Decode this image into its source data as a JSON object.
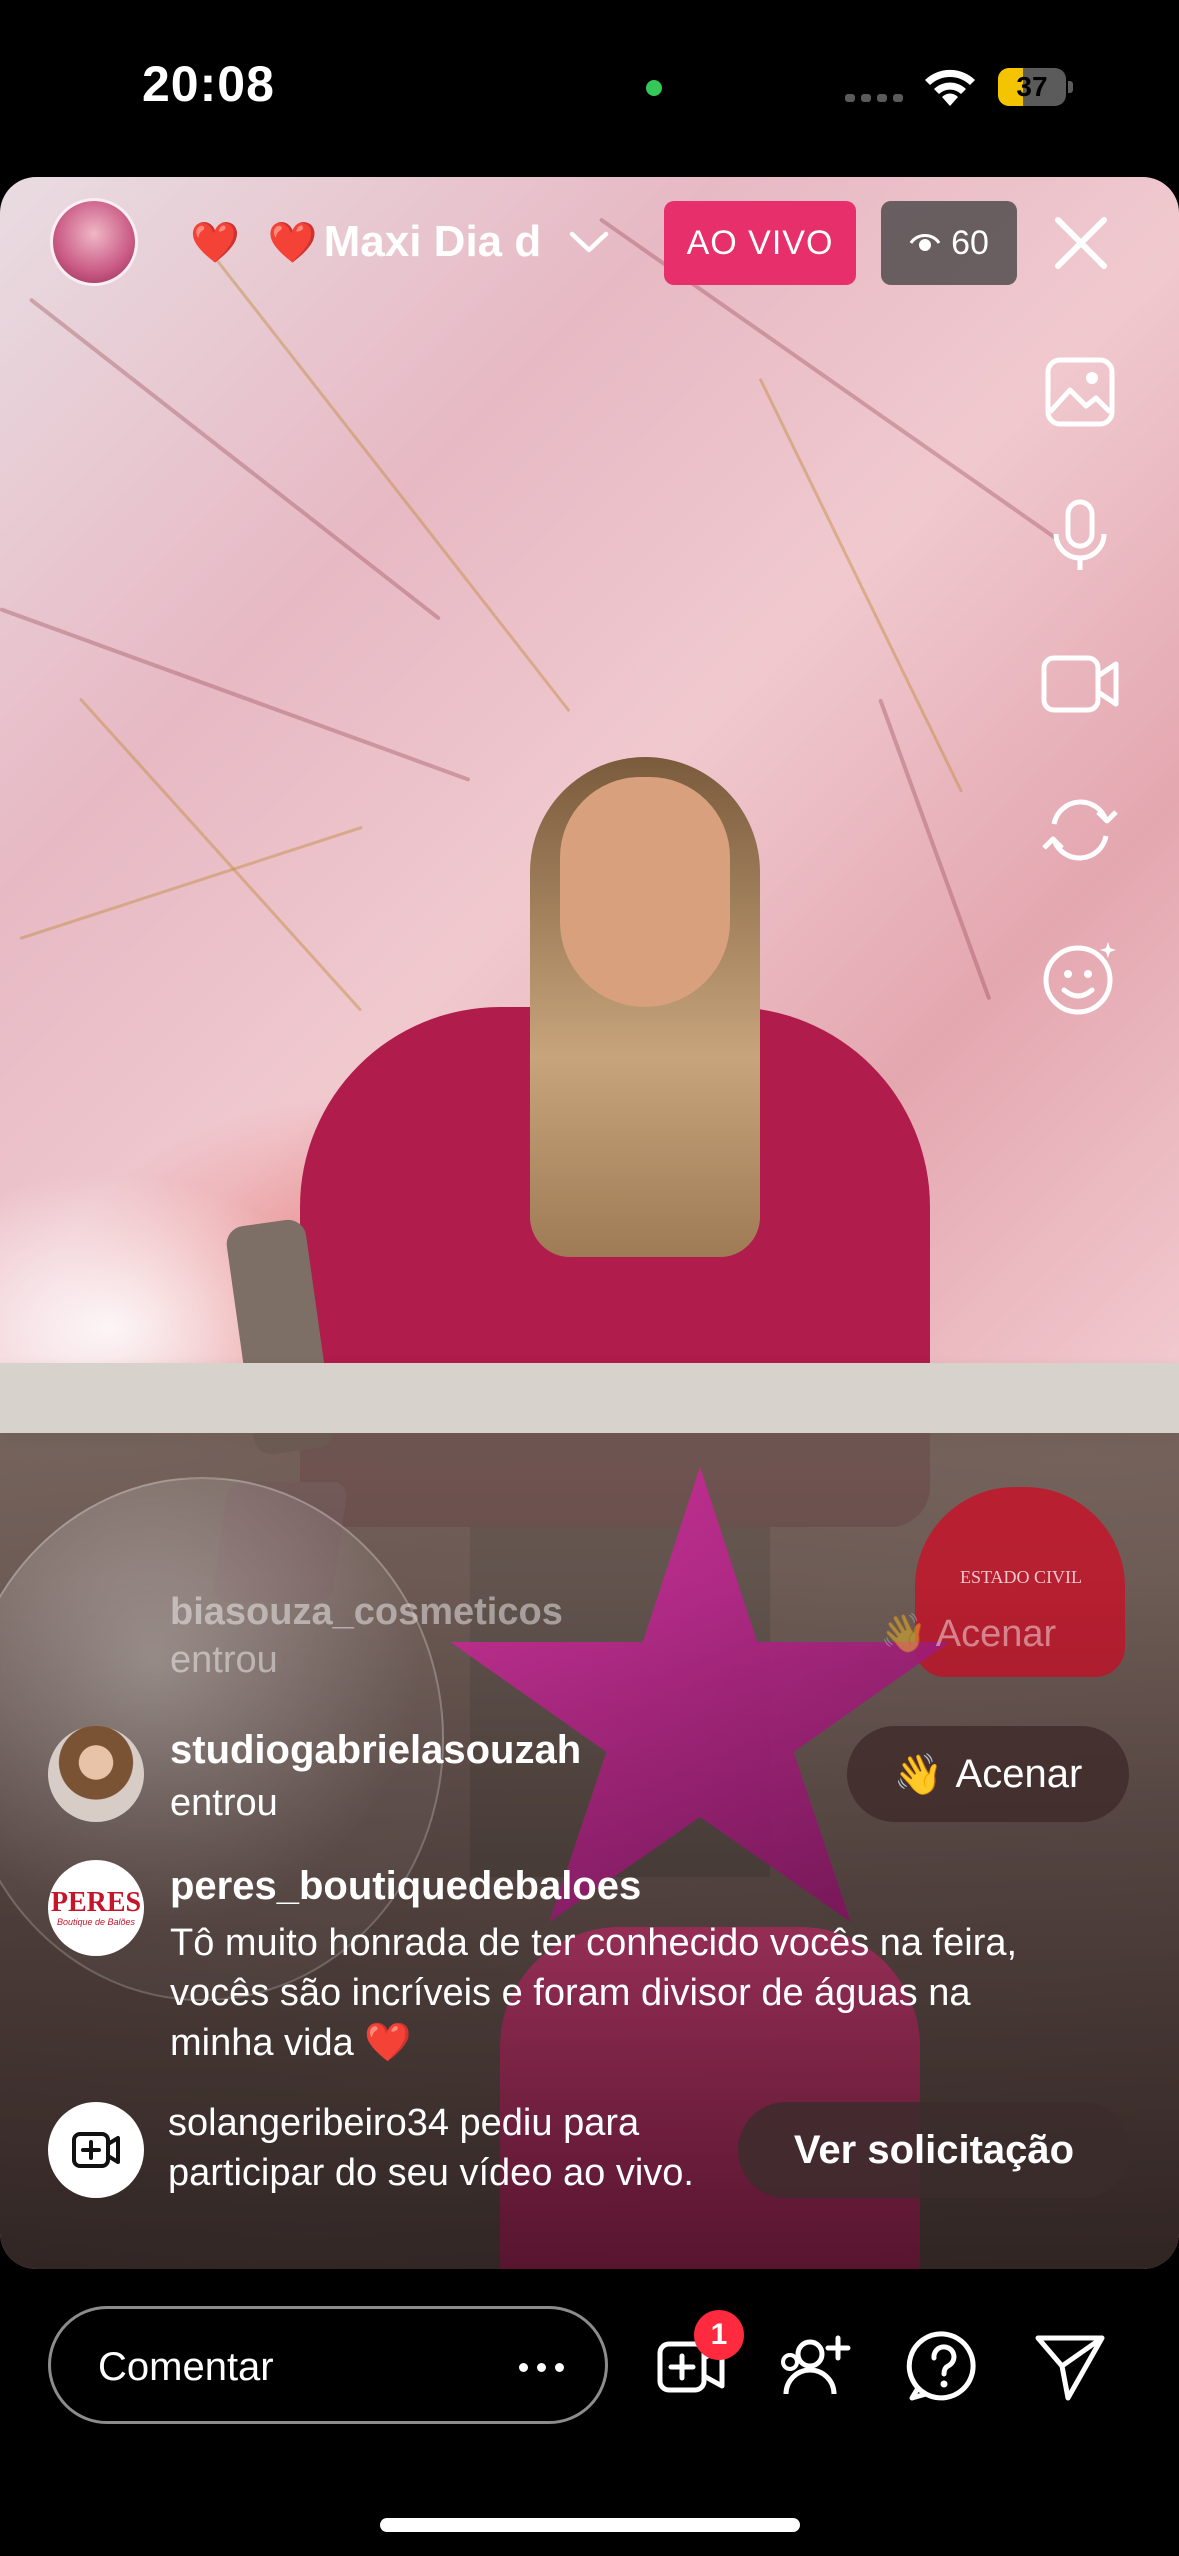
{
  "status_bar": {
    "time": "20:08",
    "battery": "37",
    "battery_level": 0.37
  },
  "live": {
    "host_avatar_icon": "host-avatar",
    "title": "Maxi Dia d",
    "title_emoji": "❤️",
    "title_prefix_emoji": "❤️",
    "live_badge": "AO VIVO",
    "viewer_count": "60",
    "accent_color": "#e7306b"
  },
  "right_tools": [
    "gallery-icon",
    "microphone-icon",
    "video-camera-icon",
    "flip-camera-icon",
    "effects-icon"
  ],
  "comments": {
    "ghost": {
      "username": "biasouza_cosmeticos",
      "text": "entrou",
      "wave": "👋 Acenar"
    },
    "joined": {
      "username": "studiogabrielasouzah",
      "text": "entrou",
      "wave_emoji": "👋",
      "wave_label": "Acenar"
    },
    "message": {
      "username": "peres_boutiquedebaloes",
      "logo_text": "PERES",
      "logo_subtext": "Boutique de Balões",
      "text": "Tô muito honrada de ter conhecido vocês na feira, vocês são incríveis e foram divisor de águas na minha vida ❤️"
    },
    "request": {
      "text": "solangeribeiro34 pediu para participar do seu vídeo ao vivo.",
      "button": "Ver solicitação"
    }
  },
  "bottom_bar": {
    "comment_placeholder": "Comentar",
    "add_guest_badge": "1",
    "icons": [
      "add-guest-icon",
      "invite-user-icon",
      "question-icon",
      "share-icon"
    ]
  },
  "video_background": {
    "heart_balloon_text": "ESTADO CIVIL"
  }
}
